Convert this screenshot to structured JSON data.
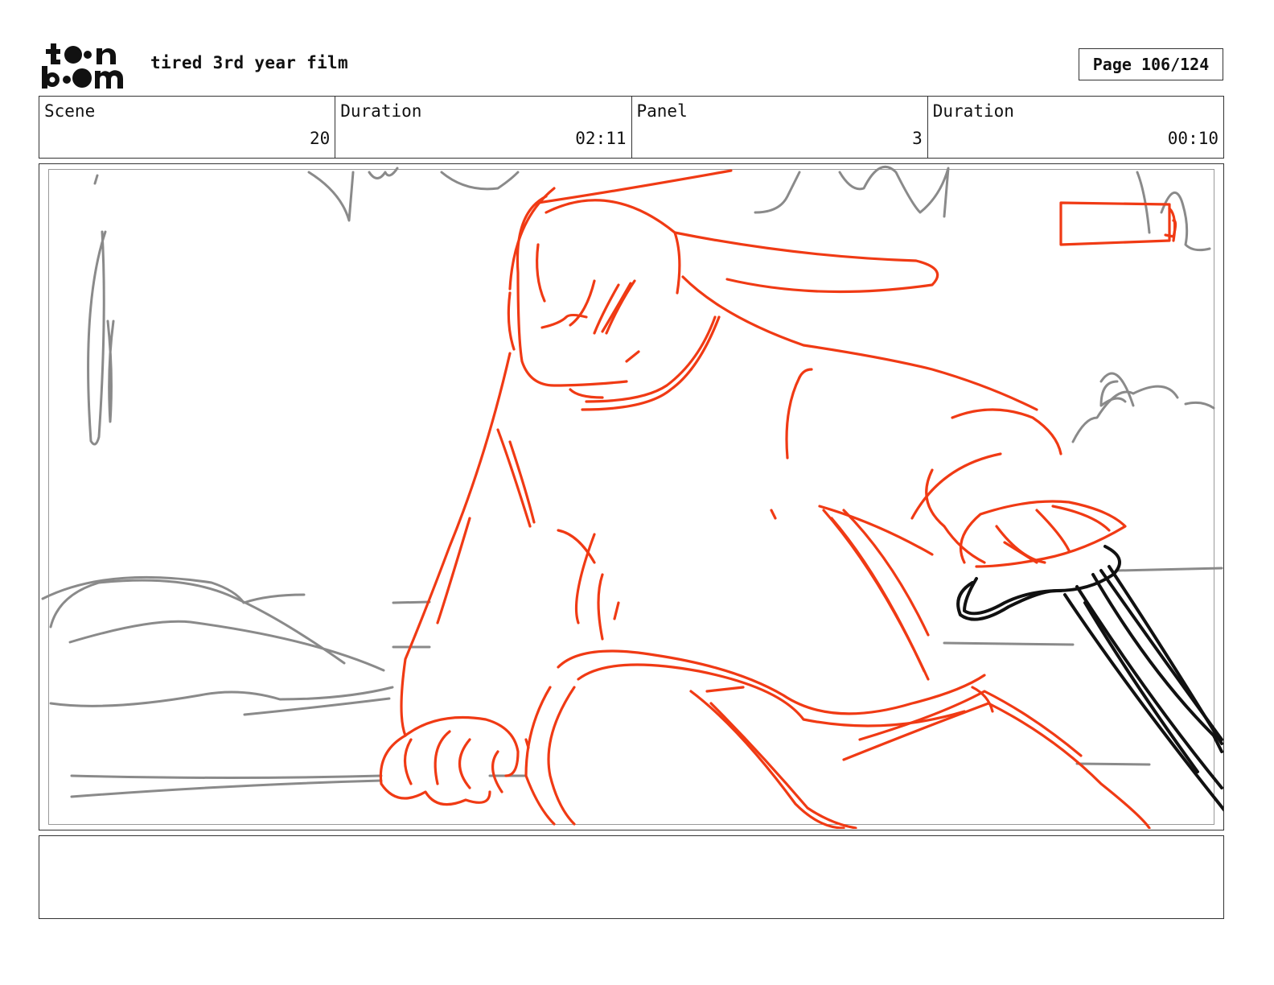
{
  "header": {
    "logo_text": "toon boom",
    "project_title": "tired 3rd year film",
    "page_label": "Page 106/124"
  },
  "info": {
    "scene_label": "Scene",
    "scene_value": "20",
    "scene_duration_label": "Duration",
    "scene_duration_value": "02:11",
    "panel_label": "Panel",
    "panel_value": "3",
    "panel_duration_label": "Duration",
    "panel_duration_value": "00:10"
  },
  "colors": {
    "sketch_red": "#f03a14",
    "sketch_gray": "#8a8a8a",
    "sketch_black": "#111111"
  },
  "caption": {
    "text": ""
  }
}
